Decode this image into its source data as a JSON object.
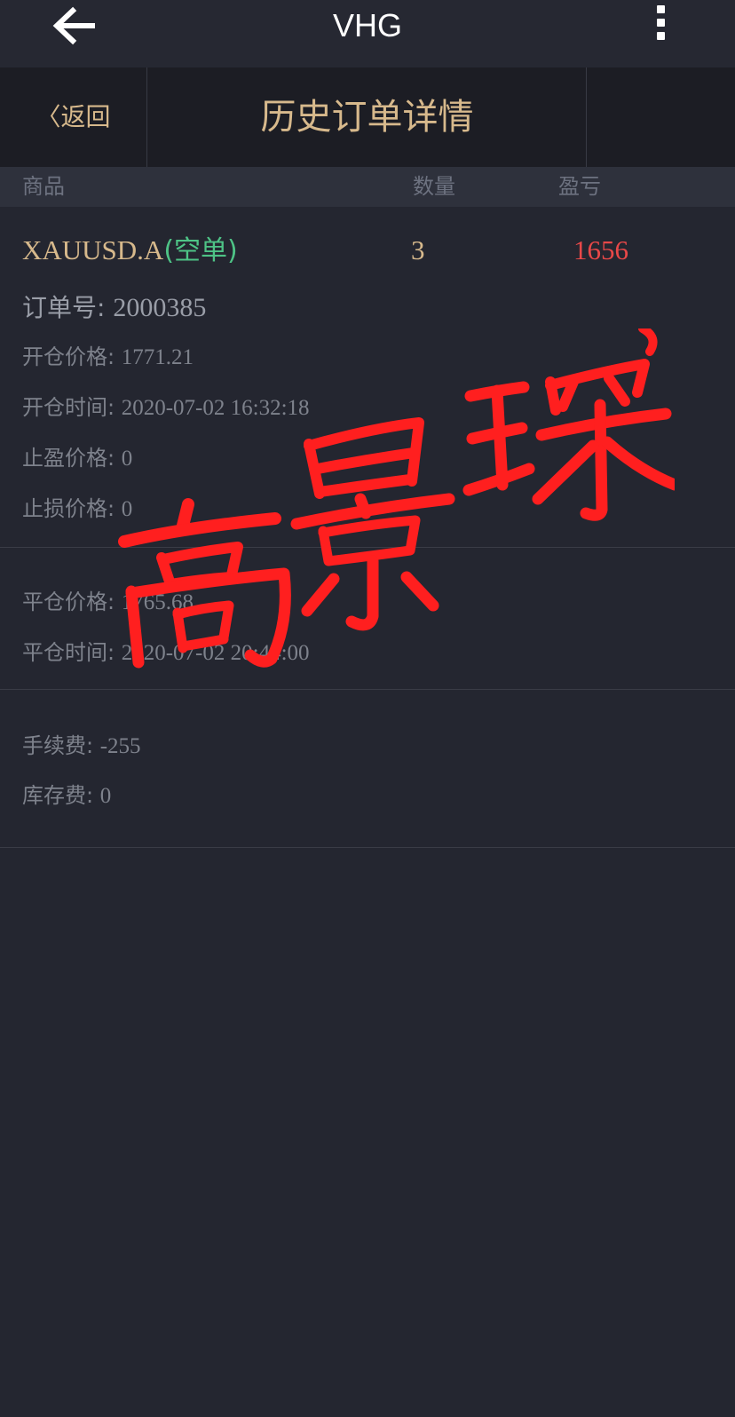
{
  "appbar": {
    "title": "VHG",
    "back_icon": "arrow-left-icon",
    "menu_icon": "more-vertical-icon"
  },
  "nav": {
    "back_label": "〈返回",
    "title": "历史订单详情"
  },
  "columns": {
    "product": "商品",
    "quantity": "数量",
    "pnl": "盈亏"
  },
  "order": {
    "symbol": "XAUUSD.A",
    "direction": "(空单)",
    "quantity": "3",
    "pnl": "1656",
    "order_no_label": "订单号:",
    "order_no": "2000385"
  },
  "open_info": [
    {
      "label": "开仓价格:",
      "value": "1771.21"
    },
    {
      "label": "开仓时间:",
      "value": "2020-07-02 16:32:18"
    },
    {
      "label": "止盈价格:",
      "value": "0"
    },
    {
      "label": "止损价格:",
      "value": "0"
    }
  ],
  "close_info": [
    {
      "label": "平仓价格:",
      "value": "1765.68"
    },
    {
      "label": "平仓时间:",
      "value": "2020-07-02 20:44:00"
    }
  ],
  "fees": [
    {
      "label": "手续费:",
      "value": "-255"
    },
    {
      "label": "库存费:",
      "value": "0"
    }
  ],
  "watermark": {
    "text": "高景琛",
    "color": "#ff1f1f"
  },
  "colors": {
    "gold": "#d7b98c",
    "green": "#4ec386",
    "red": "#e84848"
  }
}
